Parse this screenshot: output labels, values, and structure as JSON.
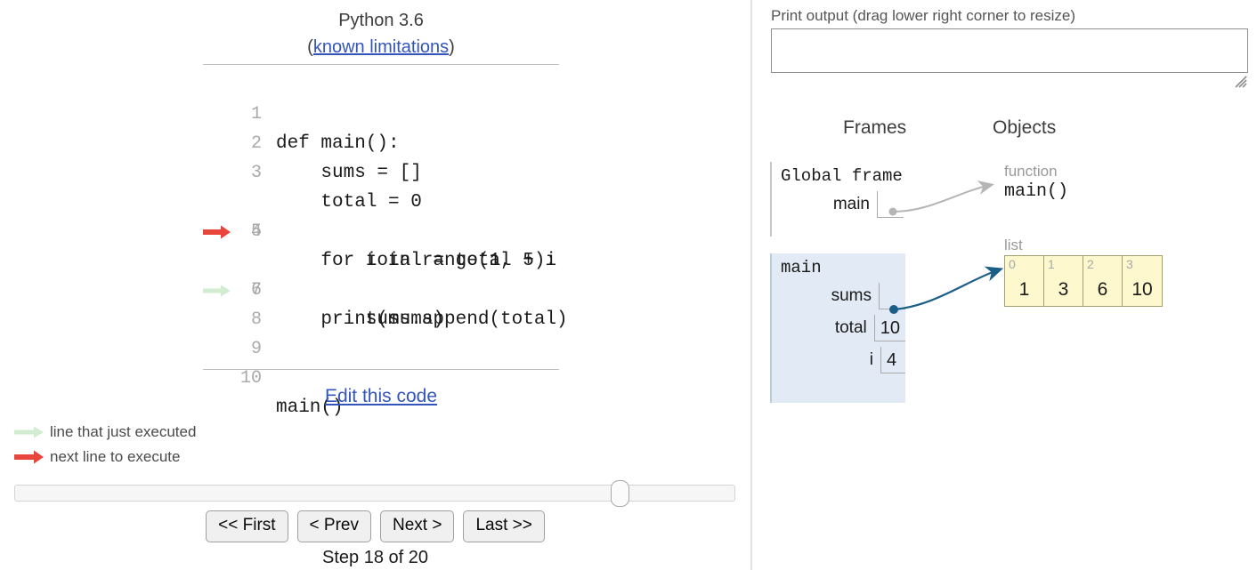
{
  "colors": {
    "next_line_arrow": "#e8453c",
    "executed_line_arrow": "#d2ecd2",
    "link": "#3355bb",
    "frame_bg": "#e2eaf5",
    "list_bg": "#fdf8cd",
    "list_border": "#a39f6e",
    "pointer_arrow": "#1b5e87",
    "function_arrow": "#b5b5b5"
  },
  "editor": {
    "python_version": "Python 3.6",
    "known_limitations_prefix": "(",
    "known_limitations_link": "known limitations",
    "known_limitations_suffix": ")",
    "edit_link": "Edit this code",
    "lines": [
      {
        "number": "1",
        "text": "def main():",
        "marker": "none"
      },
      {
        "number": "2",
        "text": "    sums = []",
        "marker": "none"
      },
      {
        "number": "3",
        "text": "    total = 0",
        "marker": "none"
      },
      {
        "number": "4",
        "text": "    for i in range(1, 5):",
        "marker": "next"
      },
      {
        "number": "5",
        "text": "        total = total + i",
        "marker": "none"
      },
      {
        "number": "6",
        "text": "        sums.append(total)",
        "marker": "executed"
      },
      {
        "number": "7",
        "text": "    print(sums)",
        "marker": "none"
      },
      {
        "number": "8",
        "text": "",
        "marker": "none"
      },
      {
        "number": "9",
        "text": "",
        "marker": "none"
      },
      {
        "number": "10",
        "text": "main()",
        "marker": "none"
      }
    ]
  },
  "legend": {
    "executed": "line that just executed",
    "next": "next line to execute"
  },
  "controls": {
    "first": "<< First",
    "prev": "< Prev",
    "next": "Next >",
    "last": "Last >>",
    "step_label": "Step 18 of 20",
    "slider_value": 18,
    "slider_min": 1,
    "slider_max": 20
  },
  "output": {
    "label": "Print output (drag lower right corner to resize)",
    "text": ""
  },
  "viz": {
    "frames_header": "Frames",
    "objects_header": "Objects",
    "frames": [
      {
        "title": "Global frame",
        "vars": [
          {
            "name": "main",
            "value": "",
            "is_pointer": true
          }
        ]
      },
      {
        "title": "main",
        "vars": [
          {
            "name": "sums",
            "value": "",
            "is_pointer": true
          },
          {
            "name": "total",
            "value": "10",
            "is_pointer": false
          },
          {
            "name": "i",
            "value": "4",
            "is_pointer": false
          }
        ]
      }
    ],
    "objects": [
      {
        "type": "function",
        "label": "main()"
      },
      {
        "type": "list",
        "elements": [
          {
            "index": "0",
            "value": "1"
          },
          {
            "index": "1",
            "value": "3"
          },
          {
            "index": "2",
            "value": "6"
          },
          {
            "index": "3",
            "value": "10"
          }
        ]
      }
    ]
  }
}
